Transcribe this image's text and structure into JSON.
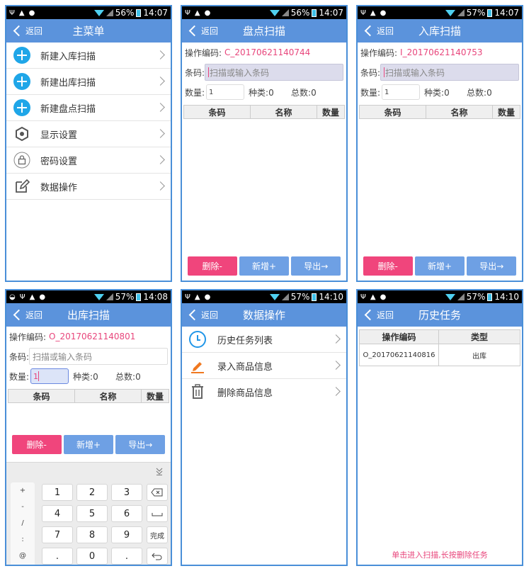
{
  "status": {
    "s1": {
      "battery": "56%",
      "time": "14:07"
    },
    "s2": {
      "battery": "56%",
      "time": "14:07"
    },
    "s3": {
      "battery": "57%",
      "time": "14:07"
    },
    "s4": {
      "battery": "57%",
      "time": "14:08"
    },
    "s5": {
      "battery": "57%",
      "time": "14:10"
    },
    "s6": {
      "battery": "57%",
      "time": "14:10"
    }
  },
  "back_label": "返回",
  "main_menu": {
    "title": "主菜单",
    "items": [
      "新建入库扫描",
      "新建出库扫描",
      "新建盘点扫描",
      "显示设置",
      "密码设置",
      "数据操作"
    ]
  },
  "stocktake": {
    "title": "盘点扫描",
    "op_label": "操作编码:",
    "op_code": "C_20170621140744",
    "barcode_label": "条码:",
    "barcode_placeholder": "扫描或输入条码",
    "qty_label": "数量:",
    "qty_value": "1",
    "kinds": "种类:0",
    "total": "总数:0"
  },
  "inbound": {
    "title": "入库扫描",
    "op_label": "操作编码:",
    "op_code": "I_20170621140753",
    "barcode_label": "条码:",
    "barcode_placeholder": "扫描或输入条码",
    "qty_label": "数量:",
    "qty_value": "1",
    "kinds": "种类:0",
    "total": "总数:0"
  },
  "outbound": {
    "title": "出库扫描",
    "op_label": "操作编码:",
    "op_code": "O_20170621140801",
    "barcode_label": "条码:",
    "barcode_placeholder": "扫描或输入条码",
    "qty_label": "数量:",
    "qty_value": "1",
    "kinds": "种类:0",
    "total": "总数:0"
  },
  "table_headers": [
    "条码",
    "名称",
    "数量"
  ],
  "buttons": {
    "delete": "删除-",
    "add": "新增+",
    "export": "导出→"
  },
  "keyboard": {
    "symbols": [
      "+",
      "-",
      "/",
      ":",
      "@"
    ],
    "keys": [
      "1",
      "2",
      "3",
      "4",
      "5",
      "6",
      "7",
      "8",
      "9",
      ".",
      "0",
      "."
    ],
    "done": "完成"
  },
  "data_ops": {
    "title": "数据操作",
    "items": [
      "历史任务列表",
      "录入商品信息",
      "删除商品信息"
    ]
  },
  "history": {
    "title": "历史任务",
    "headers": [
      "操作编码",
      "类型"
    ],
    "rows": [
      {
        "code": "O_20170621140816",
        "type": "出库"
      }
    ],
    "hint": "单击进入扫描,长按删除任务"
  },
  "colors": {
    "accent": "#5b93dc",
    "pink": "#e8467c",
    "delete": "#f0457c",
    "button": "#6ea0e4"
  }
}
